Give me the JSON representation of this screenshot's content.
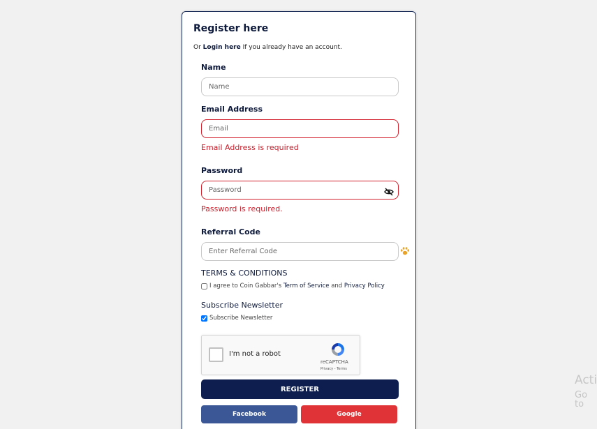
{
  "form": {
    "title": "Register here",
    "subtitle_prefix": "Or",
    "login_link": "Login here",
    "subtitle_suffix": "If you already have an account.",
    "name": {
      "label": "Name",
      "placeholder": "Name",
      "value": ""
    },
    "email": {
      "label": "Email Address",
      "placeholder": "Email",
      "value": "",
      "error": "Email Address is required"
    },
    "password": {
      "label": "Password",
      "placeholder": "Password",
      "value": "",
      "error": "Password is required."
    },
    "referral": {
      "label": "Referral Code",
      "placeholder": "Enter Referral Code",
      "value": ""
    },
    "terms": {
      "heading": "TERMS & CONDITIONS",
      "text_prefix": "I agree to Coin Gabbar's",
      "tos_link": "Term of Service",
      "and": "and",
      "privacy_link": "Privacy Policy",
      "checked": false
    },
    "newsletter": {
      "heading": "Subscribe Newsletter",
      "checkbox_label": "Subscribe Newsletter",
      "checked": true
    },
    "recaptcha": {
      "label": "I'm not a robot",
      "brand": "reCAPTCHA",
      "links": "Privacy - Terms"
    },
    "register_label": "REGISTER",
    "facebook_label": "Facebook",
    "google_label": "Google"
  },
  "watermark": {
    "line1": "Acti",
    "line2": "Go to"
  },
  "colors": {
    "primary": "#0e1f4f",
    "error": "#c91b28",
    "facebook": "#3b5796",
    "google": "#df3337"
  },
  "icons": {
    "password_toggle": "eye-slash-icon",
    "referral": "paw-icon",
    "recaptcha": "recaptcha-logo-icon"
  }
}
